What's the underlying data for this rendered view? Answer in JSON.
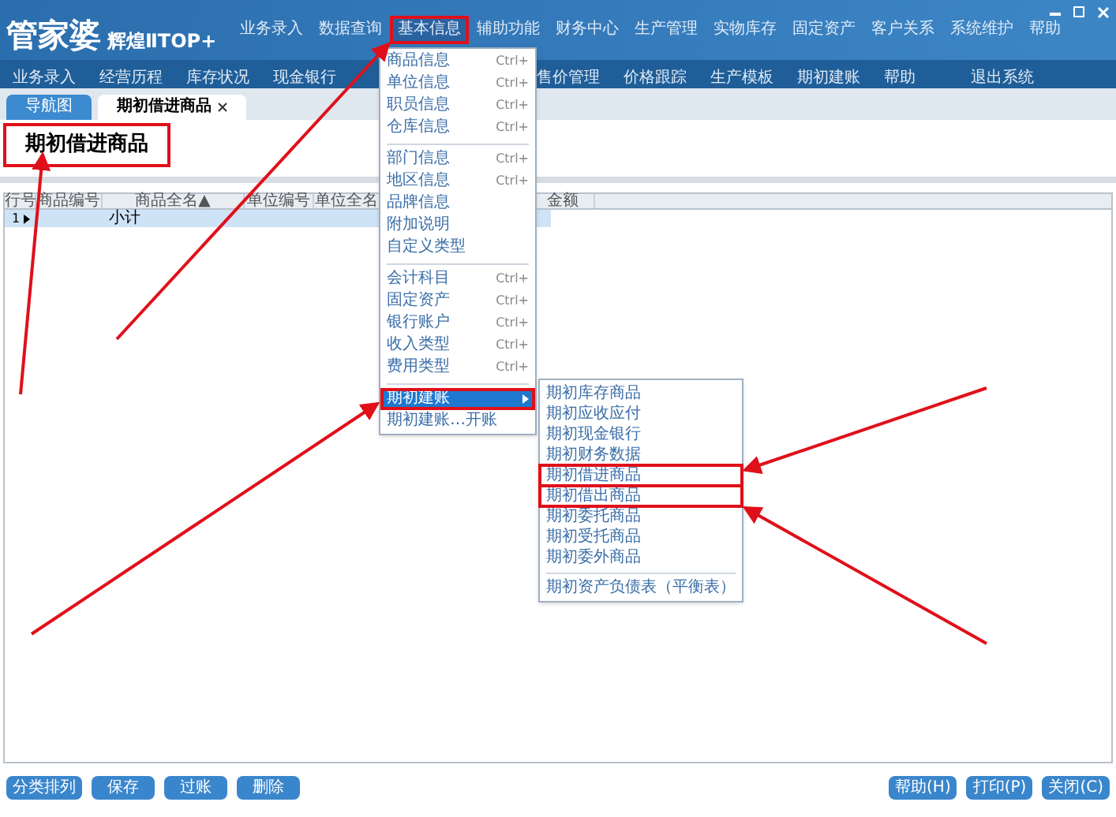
{
  "app": {
    "logo": "管家婆",
    "edition": "辉煌ⅡTOP+"
  },
  "menu_bar": [
    {
      "label": "业务录入",
      "selected": false
    },
    {
      "label": "数据查询",
      "selected": false
    },
    {
      "label": "基本信息",
      "selected": true
    },
    {
      "label": "辅助功能",
      "selected": false
    },
    {
      "label": "财务中心",
      "selected": false
    },
    {
      "label": "生产管理",
      "selected": false
    },
    {
      "label": "实物库存",
      "selected": false
    },
    {
      "label": "固定资产",
      "selected": false
    },
    {
      "label": "客户关系",
      "selected": false
    },
    {
      "label": "系统维护",
      "selected": false
    },
    {
      "label": "帮助",
      "selected": false
    }
  ],
  "toolbar": [
    {
      "label": "业务录入"
    },
    {
      "label": "经营历程"
    },
    {
      "label": "库存状况"
    },
    {
      "label": "现金银行"
    },
    {
      "label": "售价管理"
    },
    {
      "label": "价格跟踪"
    },
    {
      "label": "生产模板"
    },
    {
      "label": "期初建账"
    },
    {
      "label": "帮助"
    },
    {
      "label": "退出系统"
    }
  ],
  "tabs": [
    {
      "label": "导航图",
      "selected": false,
      "closable": false
    },
    {
      "label": "期初借进商品",
      "selected": true,
      "closable": true
    }
  ],
  "page_title": "期初借进商品",
  "table": {
    "columns": [
      "行号",
      "商品编号",
      "商品全名▲",
      "单位编号",
      "单位全名",
      "金额"
    ],
    "rows": [
      {
        "row_number": "1",
        "current": true,
        "name": "小计"
      }
    ]
  },
  "dropdown_menu": [
    {
      "kind": "item",
      "label": "商品信息",
      "shortcut": "Ctrl+",
      "selected": false,
      "has_submenu": false
    },
    {
      "kind": "item",
      "label": "单位信息",
      "shortcut": "Ctrl+",
      "selected": false,
      "has_submenu": false
    },
    {
      "kind": "item",
      "label": "职员信息",
      "shortcut": "Ctrl+",
      "selected": false,
      "has_submenu": false
    },
    {
      "kind": "item",
      "label": "仓库信息",
      "shortcut": "Ctrl+",
      "selected": false,
      "has_submenu": false
    },
    {
      "kind": "separator"
    },
    {
      "kind": "item",
      "label": "部门信息",
      "shortcut": "Ctrl+",
      "selected": false,
      "has_submenu": false
    },
    {
      "kind": "item",
      "label": "地区信息",
      "shortcut": "Ctrl+",
      "selected": false,
      "has_submenu": false
    },
    {
      "kind": "item",
      "label": "品牌信息",
      "selected": false,
      "has_submenu": false
    },
    {
      "kind": "item",
      "label": "附加说明",
      "selected": false,
      "has_submenu": false
    },
    {
      "kind": "item",
      "label": "自定义类型",
      "selected": false,
      "has_submenu": false
    },
    {
      "kind": "separator"
    },
    {
      "kind": "item",
      "label": "会计科目",
      "shortcut": "Ctrl+",
      "selected": false,
      "has_submenu": false
    },
    {
      "kind": "item",
      "label": "固定资产",
      "shortcut": "Ctrl+",
      "selected": false,
      "has_submenu": false
    },
    {
      "kind": "item",
      "label": "银行账户",
      "shortcut": "Ctrl+",
      "selected": false,
      "has_submenu": false
    },
    {
      "kind": "item",
      "label": "收入类型",
      "shortcut": "Ctrl+",
      "selected": false,
      "has_submenu": false
    },
    {
      "kind": "item",
      "label": "费用类型",
      "shortcut": "Ctrl+",
      "selected": false,
      "has_submenu": false
    },
    {
      "kind": "separator"
    },
    {
      "kind": "item",
      "label": "期初建账",
      "selected": true,
      "has_submenu": true
    },
    {
      "kind": "item",
      "label": "期初建账…开账",
      "selected": false,
      "has_submenu": false
    }
  ],
  "submenu": [
    {
      "kind": "item",
      "label": "期初库存商品",
      "highlighted": false
    },
    {
      "kind": "item",
      "label": "期初应收应付",
      "highlighted": false
    },
    {
      "kind": "item",
      "label": "期初现金银行",
      "highlighted": false
    },
    {
      "kind": "item",
      "label": "期初财务数据",
      "highlighted": false
    },
    {
      "kind": "item",
      "label": "期初借进商品",
      "highlighted": true
    },
    {
      "kind": "item",
      "label": "期初借出商品",
      "highlighted": true
    },
    {
      "kind": "item",
      "label": "期初委托商品",
      "highlighted": false
    },
    {
      "kind": "item",
      "label": "期初受托商品",
      "highlighted": false
    },
    {
      "kind": "item",
      "label": "期初委外商品",
      "highlighted": false
    },
    {
      "kind": "separator"
    },
    {
      "kind": "item",
      "label": "期初资产负债表（平衡表）",
      "highlighted": false
    }
  ],
  "bottom_left_buttons": [
    "分类排列",
    "保存",
    "过账",
    "删除"
  ],
  "bottom_right_buttons": [
    "帮助(H)",
    "打印(P)",
    "关闭(C)"
  ]
}
